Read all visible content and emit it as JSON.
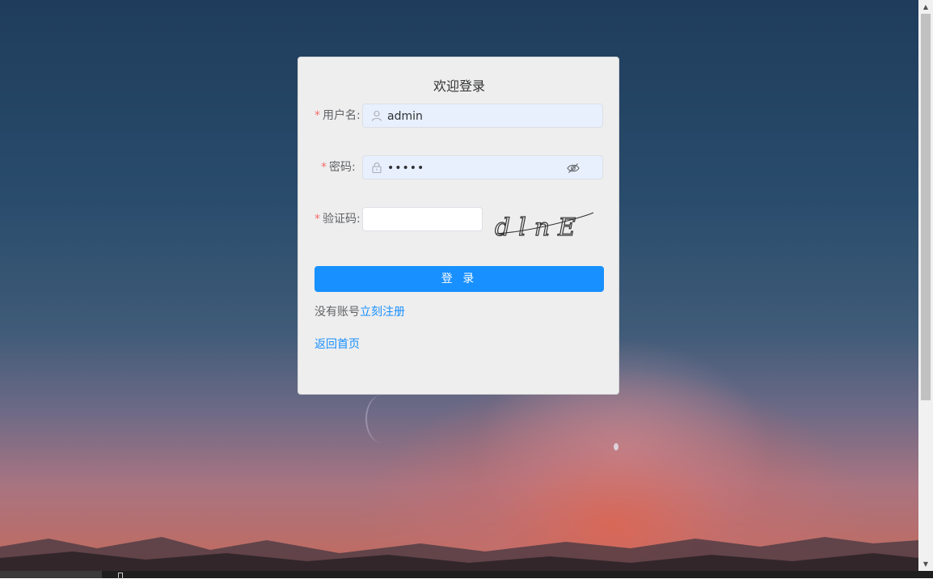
{
  "login": {
    "title": "欢迎登录",
    "username": {
      "label": "用户名:",
      "value": "admin",
      "icon": "user-icon"
    },
    "password": {
      "label": "密码:",
      "value": "•••••",
      "icon": "lock-icon",
      "toggle_icon": "eye-hidden-icon"
    },
    "captcha": {
      "label": "验证码:",
      "value": "",
      "image_text": "dlnE"
    },
    "required_mark": "*",
    "submit_label": "登 录",
    "register_prompt": "没有账号",
    "register_link": "立刻注册",
    "back_link": "返回首页"
  },
  "colors": {
    "primary": "#1890ff",
    "required": "#f56c6c",
    "card_bg": "#eeeeee"
  }
}
